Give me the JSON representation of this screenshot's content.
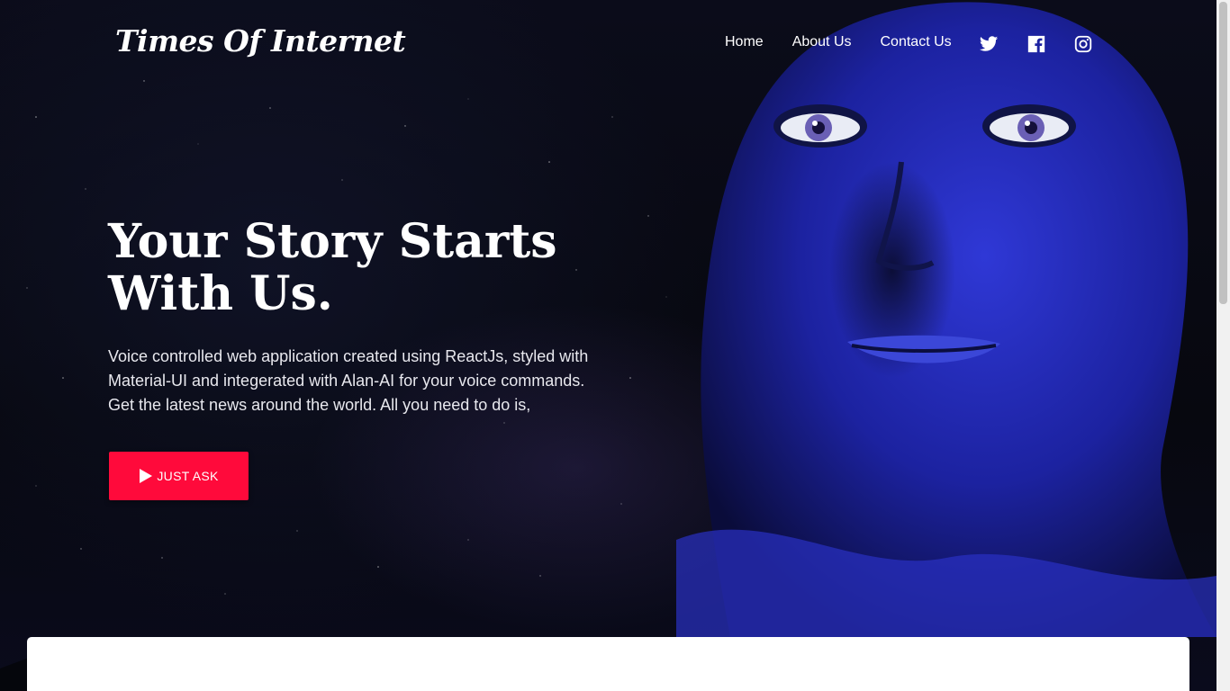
{
  "brand": {
    "logo_text": "Times Of Internet"
  },
  "nav": {
    "links": [
      {
        "label": "Home"
      },
      {
        "label": "About Us"
      },
      {
        "label": "Contact Us"
      }
    ],
    "social": [
      {
        "icon": "twitter-icon"
      },
      {
        "icon": "facebook-icon"
      },
      {
        "icon": "instagram-icon"
      }
    ]
  },
  "hero": {
    "headline_line1": "Your Story Starts",
    "headline_line2": "With Us.",
    "subtext": "Voice controlled web application created using ReactJs, styled with Material-UI and integerated with Alan-AI for your voice commands. Get the latest news around the world. All you need to do is,",
    "cta_label": "JUST ASK",
    "cta_icon": "play-icon"
  },
  "colors": {
    "accent": "#ff0a3b",
    "background": "#070812",
    "face": "#2a2fd0"
  }
}
